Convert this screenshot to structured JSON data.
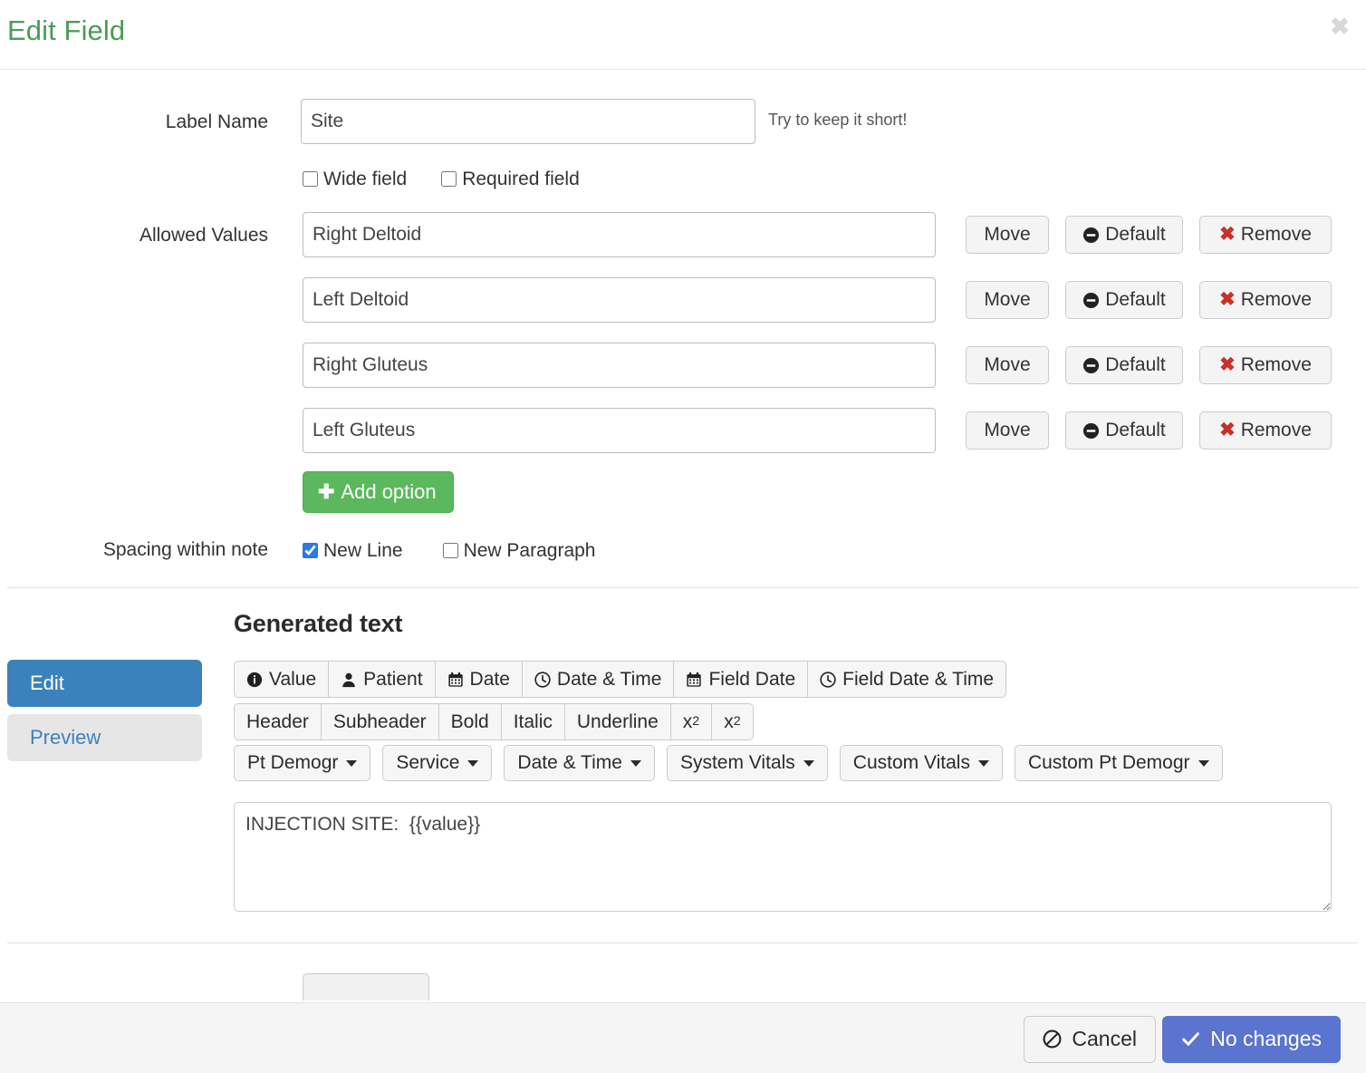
{
  "header": {
    "title": "Edit Field",
    "close_label": "✖"
  },
  "form": {
    "label_name": {
      "label": "Label Name",
      "value": "Site",
      "placeholder": "",
      "hint": "Try to keep it short!"
    },
    "checkboxes": [
      {
        "label": "Wide field",
        "checked": false
      },
      {
        "label": "Required field",
        "checked": false
      }
    ],
    "allowed_values": {
      "label": "Allowed Values",
      "rows": [
        {
          "value": "Right Deltoid",
          "move": "Move",
          "default": "Default",
          "remove": "Remove"
        },
        {
          "value": "Left Deltoid",
          "move": "Move",
          "default": "Default",
          "remove": "Remove"
        },
        {
          "value": "Right Gluteus",
          "move": "Move",
          "default": "Default",
          "remove": "Remove"
        },
        {
          "value": "Left Gluteus",
          "move": "Move",
          "default": "Default",
          "remove": "Remove"
        }
      ],
      "add_option": "Add option"
    },
    "spacing": {
      "label": "Spacing within note",
      "options": [
        {
          "label": "New Line",
          "checked": true
        },
        {
          "label": "New Paragraph",
          "checked": false
        }
      ]
    }
  },
  "generated": {
    "title": "Generated text",
    "mode_buttons": [
      {
        "label": "Edit",
        "active": true
      },
      {
        "label": "Preview",
        "active": false
      }
    ],
    "insert_toolbar": [
      {
        "label": "Value",
        "icon": "info-circle-icon"
      },
      {
        "label": "Patient",
        "icon": "user-icon"
      },
      {
        "label": "Date",
        "icon": "calendar-icon"
      },
      {
        "label": "Date & Time",
        "icon": "clock-icon"
      },
      {
        "label": "Field Date",
        "icon": "calendar-icon"
      },
      {
        "label": "Field Date & Time",
        "icon": "clock-icon"
      }
    ],
    "format_toolbar": [
      {
        "label": "Header"
      },
      {
        "label": "Subheader"
      },
      {
        "label": "Bold"
      },
      {
        "label": "Italic"
      },
      {
        "label": "Underline"
      },
      {
        "label": "x",
        "sub": "2"
      },
      {
        "label": "x",
        "sup": "2"
      }
    ],
    "dropdowns": [
      {
        "label": "Pt Demogr"
      },
      {
        "label": "Service"
      },
      {
        "label": "Date & Time"
      },
      {
        "label": "System Vitals"
      },
      {
        "label": "Custom Vitals"
      },
      {
        "label": "Custom Pt Demogr"
      }
    ],
    "textarea_value": "INJECTION SITE:  {{value}}",
    "textarea_placeholder": ""
  },
  "footer": {
    "cancel": "Cancel",
    "confirm": "No changes"
  },
  "colors": {
    "title_green": "#4a9c54",
    "primary_blue": "#3b82bd",
    "confirm_blue": "#5a74cf",
    "add_green": "#5cb85c",
    "remove_red": "#c9302c",
    "footer_bg": "#f5f5f5"
  }
}
